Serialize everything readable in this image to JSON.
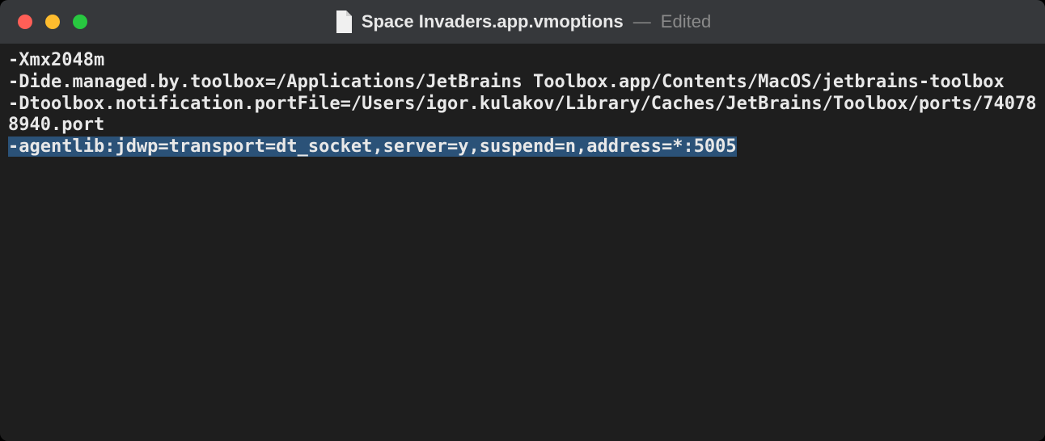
{
  "titlebar": {
    "filename": "Space Invaders.app.vmoptions",
    "separator": "—",
    "status": "Edited"
  },
  "editor": {
    "lines": [
      "-Xmx2048m",
      "-Dide.managed.by.toolbox=/Applications/JetBrains Toolbox.app/Contents/MacOS/jetbrains-toolbox",
      "-Dtoolbox.notification.portFile=/Users/igor.kulakov/Library/Caches/JetBrains/Toolbox/ports/740788940.port"
    ],
    "selected_line": "-agentlib:jdwp=transport=dt_socket,server=y,suspend=n,address=*:5005"
  }
}
